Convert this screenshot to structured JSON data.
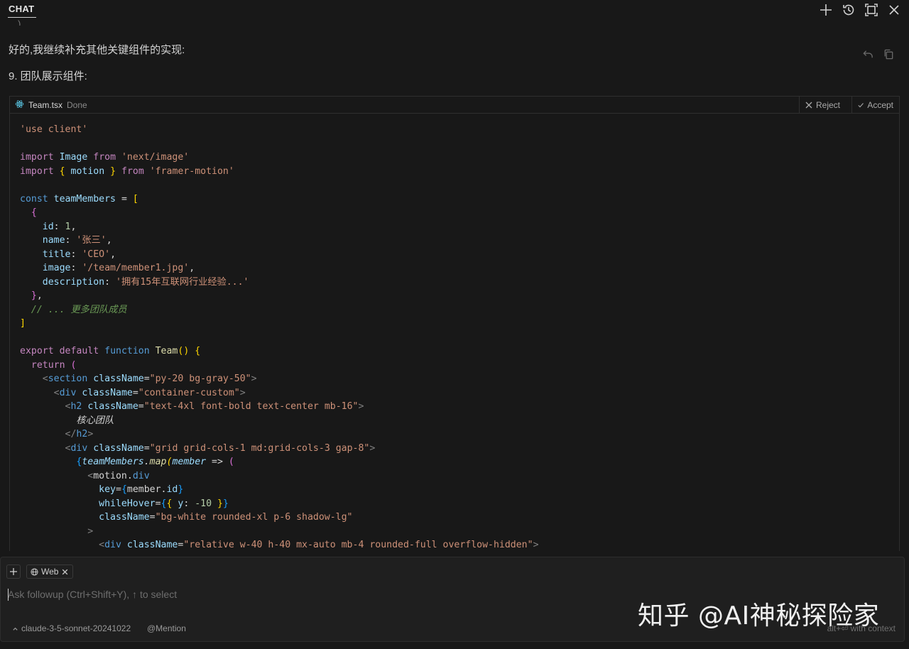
{
  "header": {
    "tab": "CHAT"
  },
  "message": {
    "cut_text": "…)… , …",
    "line1": "好的,我继续补充其他关键组件的实现:",
    "line2": "9. 团队展示组件:"
  },
  "codeblock": {
    "filename": "Team.tsx",
    "status": "Done",
    "reject_label": "Reject",
    "accept_label": "Accept"
  },
  "input": {
    "web_chip": "Web",
    "placeholder": "Ask followup (Ctrl+Shift+Y), ↑ to select",
    "model": "claude-3-5-sonnet-20241022",
    "mention": "@Mention",
    "context_hint": "alt+⏎ with context"
  },
  "watermark": "知乎 @AI神秘探险家",
  "icons": [
    "new-chat-icon",
    "history-icon",
    "maximize-icon",
    "close-icon",
    "undo-icon",
    "copy-icon",
    "react-icon",
    "plus-icon",
    "globe-icon"
  ]
}
